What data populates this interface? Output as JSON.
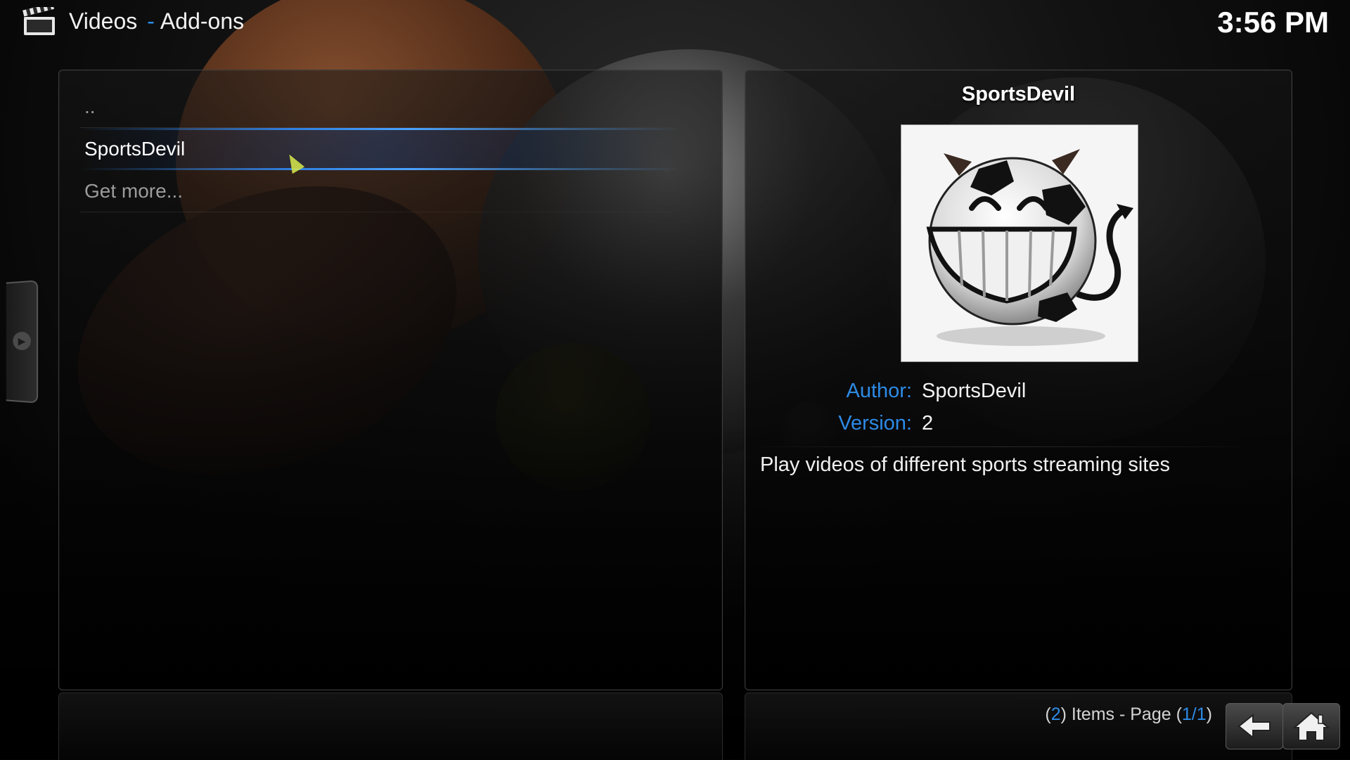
{
  "header": {
    "section": "Videos",
    "separator": "-",
    "subsection": "Add-ons",
    "clock": "3:56 PM"
  },
  "list": {
    "items": [
      {
        "label": "..",
        "selected": false
      },
      {
        "label": "SportsDevil",
        "selected": true
      },
      {
        "label": "Get more...",
        "selected": false
      }
    ]
  },
  "details": {
    "name": "SportsDevil",
    "thumbnail_icon": "sportsdevil-logo",
    "author_label": "Author:",
    "author_value": "SportsDevil",
    "version_label": "Version:",
    "version_value": "2",
    "description": "Play videos of different sports streaming sites"
  },
  "footer": {
    "items_open": "(",
    "items_count": "2",
    "items_text": ") Items - Page (",
    "page": "1/1",
    "page_close": ")",
    "back_icon": "back-arrow-icon",
    "home_icon": "home-icon"
  },
  "colors": {
    "accent": "#2d8be6",
    "text": "#ececec",
    "background": "#050505"
  }
}
